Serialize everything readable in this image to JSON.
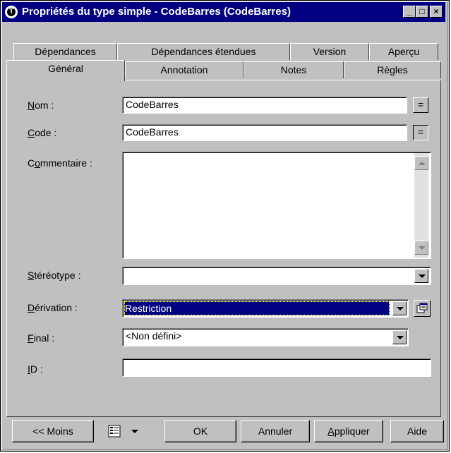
{
  "window": {
    "title": "Propriétés du type simple - CodeBarres (CodeBarres)",
    "minimize_label": "_",
    "maximize_label": "□",
    "close_label": "×"
  },
  "tabs_back": [
    {
      "label": "Dépendances"
    },
    {
      "label": "Dépendances étendues"
    },
    {
      "label": "Version"
    },
    {
      "label": "Aperçu"
    }
  ],
  "tabs_front": [
    {
      "label": "Général",
      "active": true
    },
    {
      "label": "Annotation"
    },
    {
      "label": "Notes"
    },
    {
      "label": "Règles"
    }
  ],
  "form": {
    "nom": {
      "label_u": "N",
      "label_rest": "om :",
      "value": "CodeBarres",
      "button": "="
    },
    "code": {
      "label_u": "C",
      "label_rest": "ode :",
      "value": "CodeBarres",
      "button": "="
    },
    "commentaire": {
      "label_pre": "C",
      "label_u": "o",
      "label_rest": "mmentaire :",
      "value": ""
    },
    "stereotype": {
      "label_u": "S",
      "label_rest": "téréotype :",
      "value": ""
    },
    "derivation": {
      "label_u": "D",
      "label_rest": "érivation :",
      "value": "Restriction"
    },
    "final": {
      "label_u": "F",
      "label_rest": "inal :",
      "value": "<Non défini>"
    },
    "id": {
      "label_u": "I",
      "label_rest": "D :",
      "value": ""
    }
  },
  "buttons": {
    "moins": "<< Moins",
    "ok": "OK",
    "annuler": "Annuler",
    "appliquer_u": "A",
    "appliquer_rest": "ppliquer",
    "aide": "Aide"
  }
}
